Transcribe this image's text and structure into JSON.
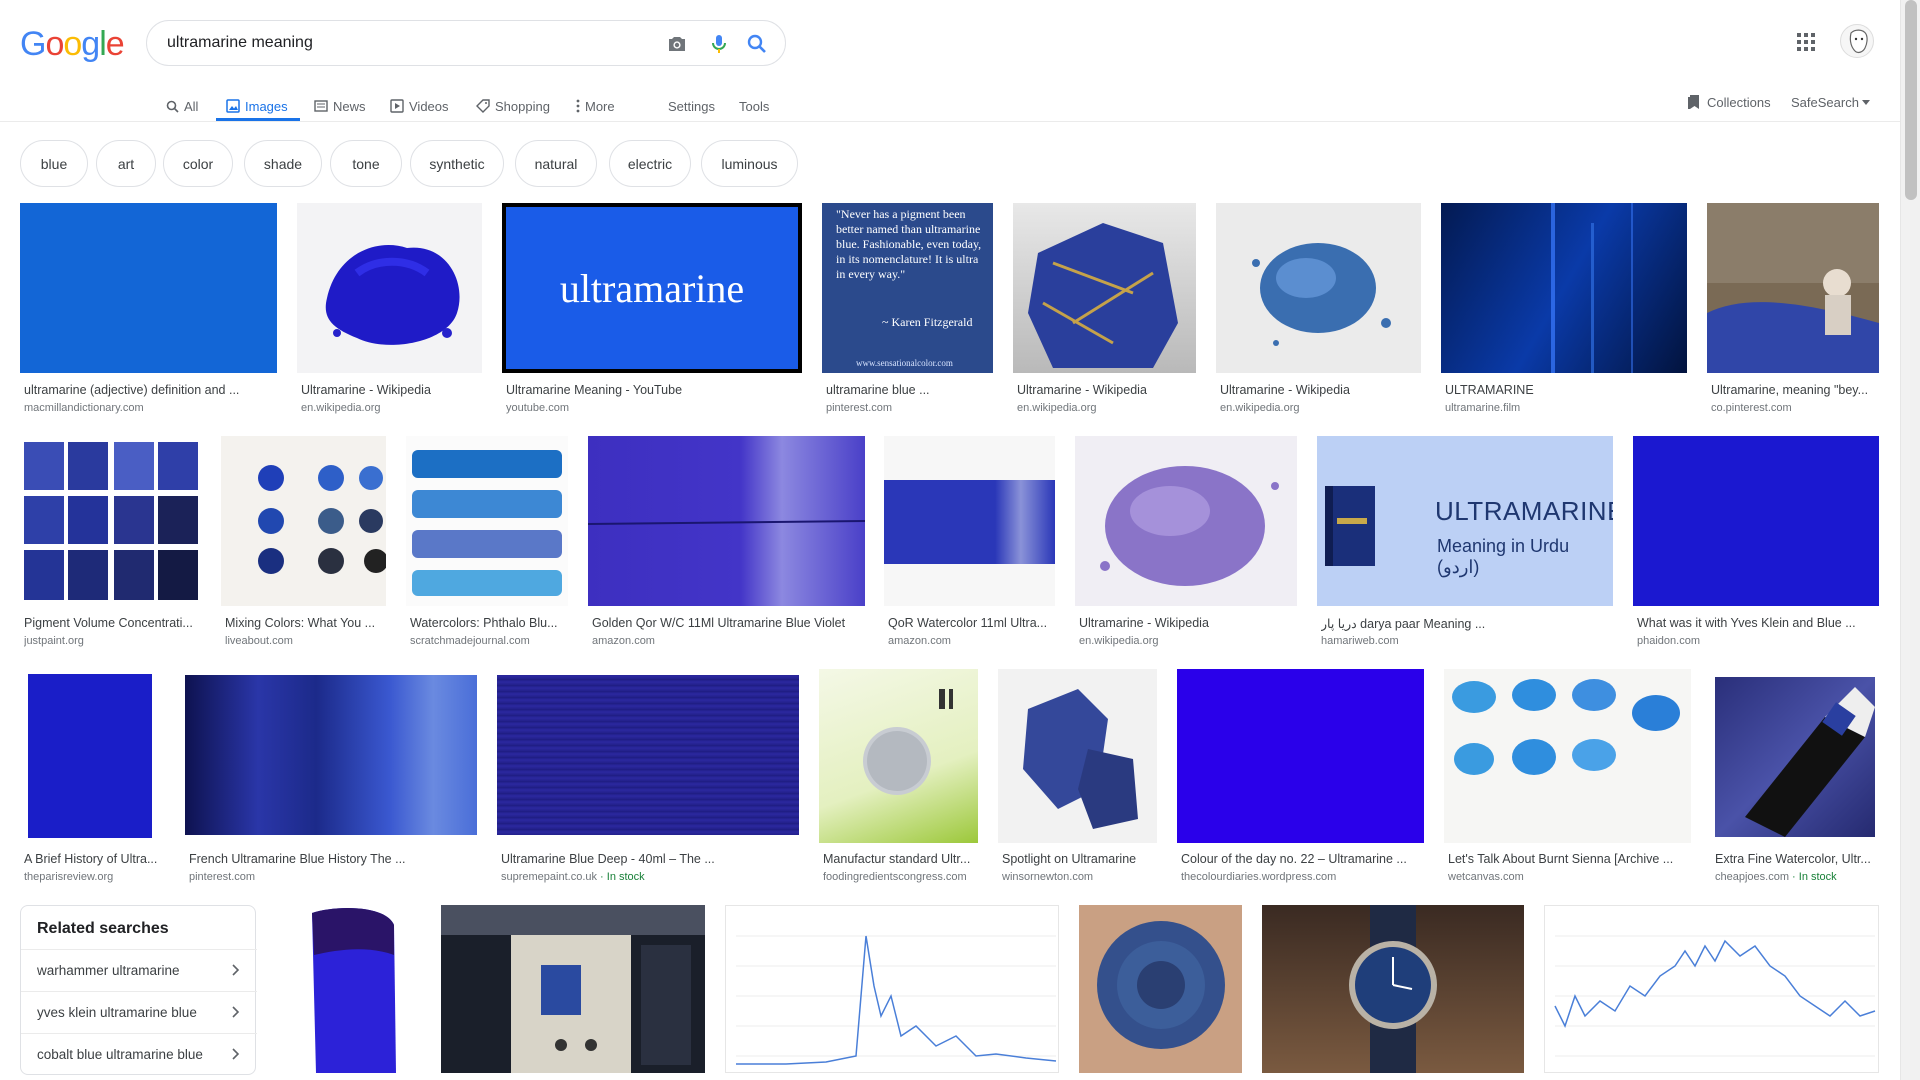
{
  "search": {
    "query": "ultramarine meaning"
  },
  "header": {
    "logo_letters": [
      "G",
      "o",
      "o",
      "g",
      "l",
      "e"
    ],
    "logo_colors": [
      "#4285f4",
      "#ea4335",
      "#fbbc05",
      "#4285f4",
      "#34a853",
      "#ea4335"
    ]
  },
  "tabs": {
    "all": "All",
    "images": "Images",
    "news": "News",
    "videos": "Videos",
    "shopping": "Shopping",
    "more": "More",
    "settings": "Settings",
    "tools": "Tools",
    "collections": "Collections",
    "safesearch": "SafeSearch"
  },
  "chips": [
    "blue",
    "art",
    "color",
    "shade",
    "tone",
    "synthetic",
    "natural",
    "electric",
    "luminous"
  ],
  "thumb_text": {
    "yt": "ultramarine",
    "quote": "\"Never has a pigment been better named than ultramarine blue. Fashionable, even today, in its nomenclature! It is ultra in every way.\"",
    "quote_author": "~ Karen Fitzgerald",
    "quote_site": "www.sensationalcolor.com",
    "urdu_title": "ULTRAMARINE",
    "urdu_sub": "Meaning in Urdu (اردو)"
  },
  "results": {
    "r1": [
      {
        "title": "ultramarine (adjective) definition and ...",
        "source": "macmillandictionary.com"
      },
      {
        "title": "Ultramarine - Wikipedia",
        "source": "en.wikipedia.org"
      },
      {
        "title": "Ultramarine Meaning - YouTube",
        "source": "youtube.com"
      },
      {
        "title": "ultramarine blue ...",
        "source": "pinterest.com"
      },
      {
        "title": "Ultramarine - Wikipedia",
        "source": "en.wikipedia.org"
      },
      {
        "title": "Ultramarine - Wikipedia",
        "source": "en.wikipedia.org"
      },
      {
        "title": "ULTRAMARINE",
        "source": "ultramarine.film"
      },
      {
        "title": "Ultramarine, meaning \"bey...",
        "source": "co.pinterest.com"
      }
    ],
    "r2": [
      {
        "title": "Pigment Volume Concentrati...",
        "source": "justpaint.org"
      },
      {
        "title": "Mixing Colors: What You ...",
        "source": "liveabout.com"
      },
      {
        "title": "Watercolors: Phthalo Blu...",
        "source": "scratchmadejournal.com"
      },
      {
        "title": "Golden Qor W/C 11Ml Ultramarine Blue Violet",
        "source": "amazon.com"
      },
      {
        "title": "QoR Watercolor 11ml Ultra...",
        "source": "amazon.com"
      },
      {
        "title": "Ultramarine - Wikipedia",
        "source": "en.wikipedia.org"
      },
      {
        "title": "دریا پار darya paar Meaning ...",
        "source": "hamariweb.com"
      },
      {
        "title": "What was it with Yves Klein and Blue ...",
        "source": "phaidon.com"
      }
    ],
    "r3": [
      {
        "title": "A Brief History of Ultra...",
        "source": "theparisreview.org"
      },
      {
        "title": "French Ultramarine Blue History The ...",
        "source": "pinterest.com"
      },
      {
        "title": "Ultramarine Blue Deep - 40ml – The ...",
        "source": "supremepaint.co.uk",
        "stock": " · In stock"
      },
      {
        "title": "Manufactur standard Ultr...",
        "source": "foodingredientscongress.com"
      },
      {
        "title": "Spotlight on Ultramarine",
        "source": "winsornewton.com"
      },
      {
        "title": "Colour of the day no. 22 – Ultramarine ...",
        "source": "thecolourdiaries.wordpress.com"
      },
      {
        "title": "Let's Talk About Burnt Sienna [Archive ...",
        "source": "wetcanvas.com"
      },
      {
        "title": "Extra Fine Watercolor, Ultr...",
        "source": "cheapjoes.com",
        "stock": " · In stock"
      }
    ]
  },
  "related": {
    "title": "Related searches",
    "items": [
      "warhammer ultramarine",
      "yves klein ultramarine blue",
      "cobalt blue ultramarine blue"
    ]
  }
}
